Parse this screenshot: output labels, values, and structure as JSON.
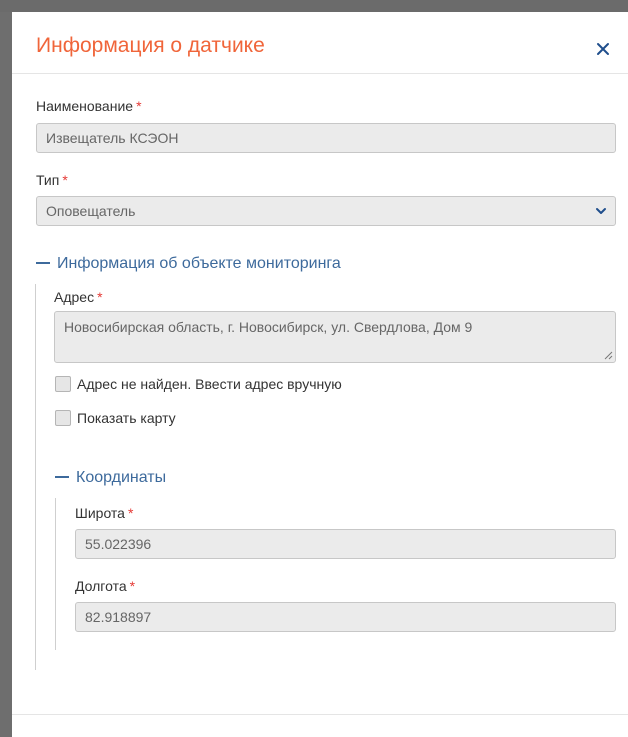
{
  "dialog": {
    "title": "Информация о датчике"
  },
  "fields": {
    "name": {
      "label": "Наименование",
      "required": "*",
      "value": "Извещатель КСЭОН"
    },
    "type": {
      "label": "Тип",
      "required": "*",
      "value": "Оповещатель"
    }
  },
  "monitoring_section": {
    "title": "Информация об объекте мониторинга",
    "address": {
      "label": "Адрес",
      "required": "*",
      "value": "Новосибирская область, г. Новосибирск, ул. Свердлова, Дом 9"
    },
    "manual_address_checkbox": {
      "label": "Адрес не найден. Ввести адрес вручную",
      "checked": false
    },
    "show_map_checkbox": {
      "label": "Показать карту",
      "checked": false
    }
  },
  "coordinates_section": {
    "title": "Координаты",
    "latitude": {
      "label": "Широта",
      "required": "*",
      "value": "55.022396"
    },
    "longitude": {
      "label": "Долгота",
      "required": "*",
      "value": "82.918897"
    }
  },
  "colors": {
    "title": "#f0653a",
    "section": "#3d6a9c",
    "required": "#e53935",
    "input_bg": "#ebebeb"
  },
  "icons": {
    "close": "close-icon",
    "select": "chevron-down-icon",
    "section_toggle": "minus-icon"
  }
}
